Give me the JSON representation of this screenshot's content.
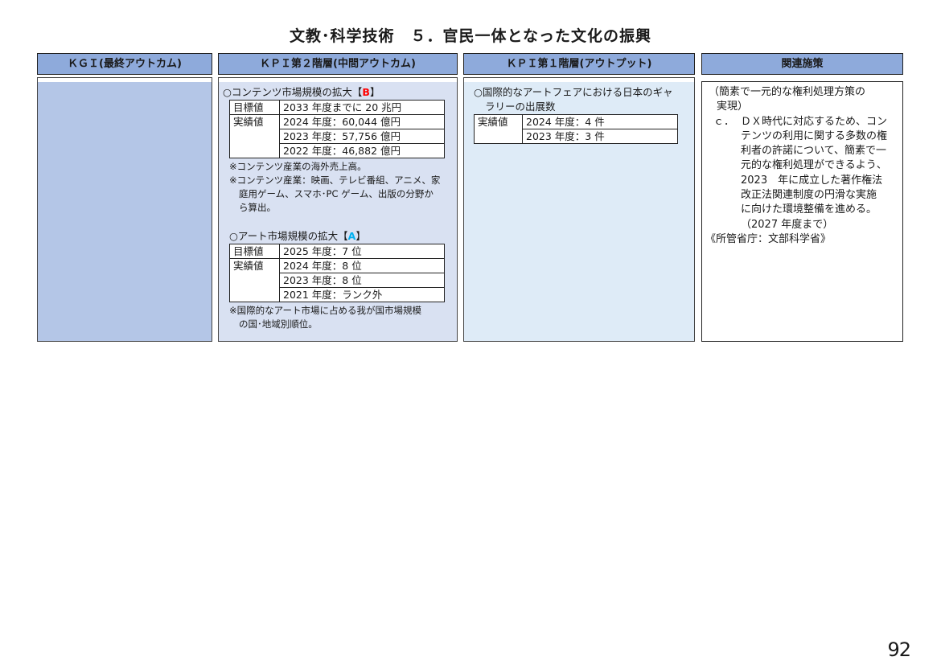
{
  "title": "文教･科学技術　５．官民一体となった文化の振興",
  "headers": {
    "kgi": "ＫＧＩ(最終アウトカム)",
    "kpi2": "ＫＰＩ第２階層(中間アウトカム)",
    "kpi1": "ＫＰＩ第１階層(アウトプット)",
    "measures": "関連施策"
  },
  "kpi2": {
    "content": {
      "heading": "○コンテンツ市場規模の拡大【",
      "grade": "B",
      "close": "】",
      "target_label": "目標値",
      "target_value": "2033 年度までに 20 兆円",
      "actual_label": "実績値",
      "actual_values": [
        "2024 年度：60,044 億円",
        "2023 年度：57,756 億円",
        "2022 年度：46,882 億円"
      ],
      "note1": "※コンテンツ産業の海外売上高。",
      "note2a": "※コンテンツ産業：映画、テレビ番組、アニメ、家",
      "note2b": "庭用ゲーム、スマホ･PC ゲーム、出版の分野か",
      "note2c": "ら算出。"
    },
    "art": {
      "heading": "○アート市場規模の拡大【",
      "grade": "A",
      "close": "】",
      "target_label": "目標値",
      "target_value": "2025 年度：7 位",
      "actual_label": "実績値",
      "actual_values": [
        "2024 年度：8 位",
        "2023 年度：8 位",
        "2021 年度：ランク外"
      ],
      "note1a": "※国際的なアート市場に占める我が国市場規模",
      "note1b": "の国･地域別順位。"
    }
  },
  "kpi1": {
    "heading_a": "○国際的なアートフェアにおける日本のギャ",
    "heading_b": "ラリーの出展数",
    "actual_label": "実績値",
    "actual_values": [
      "2024 年度：4 件",
      "2023 年度：3 件"
    ]
  },
  "measures": {
    "line1": "（簡素で一元的な権利処理方策の",
    "line2": "実現）",
    "item_marker": "ｃ．",
    "item_lines": [
      "ＤＸ時代に対応するため、コン",
      "テンツの利用に関する多数の権",
      "利者の許諾について、簡素で一",
      "元的な権利処理ができるよう、",
      "2023　年に成立した著作権法",
      "改正法関連制度の円滑な実施",
      "に向けた環境整備を進める。",
      "（2027 年度まで）"
    ],
    "ministry": "《所管省庁：文部科学省》"
  },
  "page_number": "92"
}
